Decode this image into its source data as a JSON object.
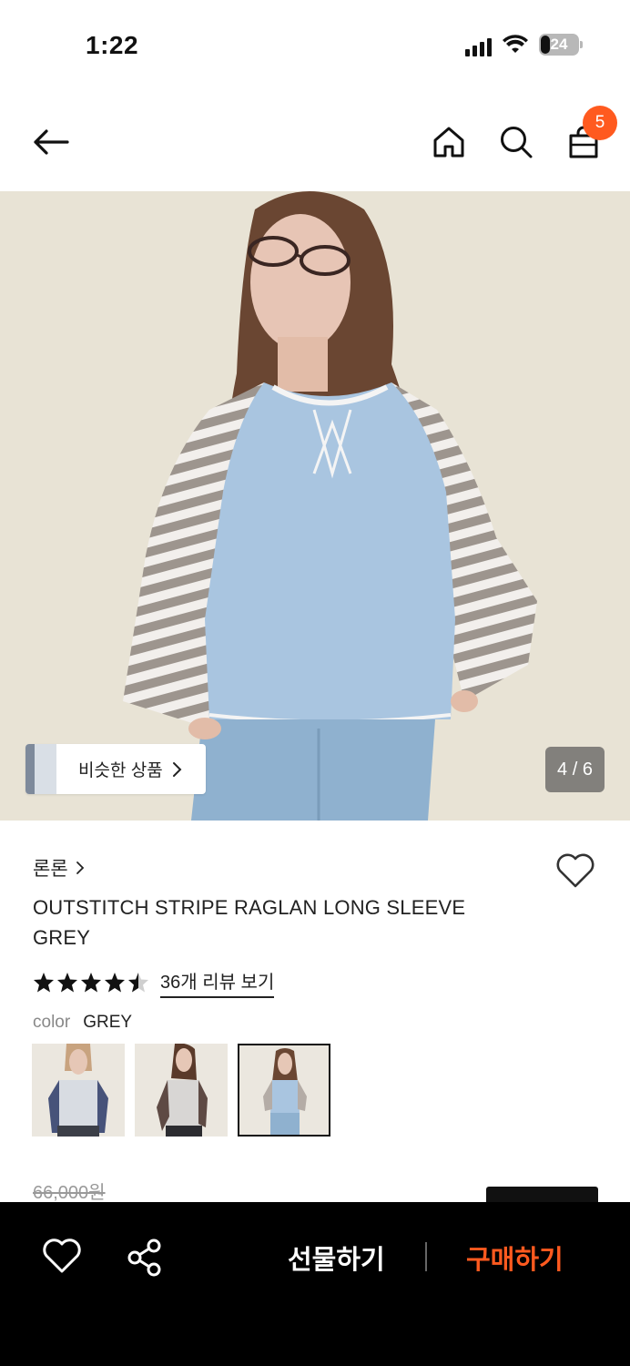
{
  "status_bar": {
    "time": "1:22",
    "battery": "24",
    "battery_level": 0.24
  },
  "header": {
    "cart_count": "5",
    "icons": [
      "back-arrow-icon",
      "home-icon",
      "search-icon",
      "shopping-bag-icon"
    ]
  },
  "gallery": {
    "similar_label": "비슷한 상품",
    "pager": "4 / 6"
  },
  "product": {
    "brand": "론론",
    "title": "OUTSTITCH STRIPE RAGLAN LONG SLEEVE GREY",
    "rating": 4.5,
    "review_link": "36개 리뷰 보기",
    "color_label": "color",
    "color_value": "GREY",
    "original_price": "66,000원"
  },
  "bottom_bar": {
    "gift_label": "선물하기",
    "buy_label": "구매하기"
  },
  "colors": {
    "accent": "#ff5a1f",
    "bottom_bar": "#000000"
  }
}
